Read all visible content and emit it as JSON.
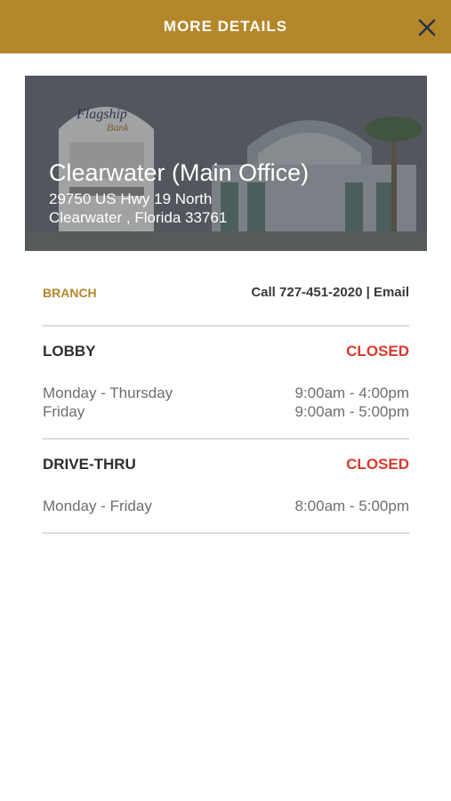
{
  "header": {
    "title": "MORE DETAILS",
    "close_icon": "close-icon"
  },
  "hero": {
    "title": "Clearwater (Main Office)",
    "address_line1": "29750 US Hwy 19 North",
    "address_line2": "Clearwater , Florida 33761",
    "sign_text_line1": "Flagship",
    "sign_text_line2": "Bank"
  },
  "info": {
    "label": "BRANCH",
    "call_text": "Call 727-451-2020",
    "separator": "|",
    "email_text": "Email"
  },
  "lobby": {
    "name": "LOBBY",
    "status": "CLOSED",
    "hours": [
      {
        "days": "Monday - Thursday",
        "time": "9:00am - 4:00pm"
      },
      {
        "days": "Friday",
        "time": "9:00am - 5:00pm"
      }
    ]
  },
  "drive_thru": {
    "name": "DRIVE-THRU",
    "status": "CLOSED",
    "hours": [
      {
        "days": "Monday - Friday",
        "time": "8:00am - 5:00pm"
      }
    ]
  },
  "colors": {
    "accent": "#b5872b",
    "closed": "#d63a2f"
  }
}
